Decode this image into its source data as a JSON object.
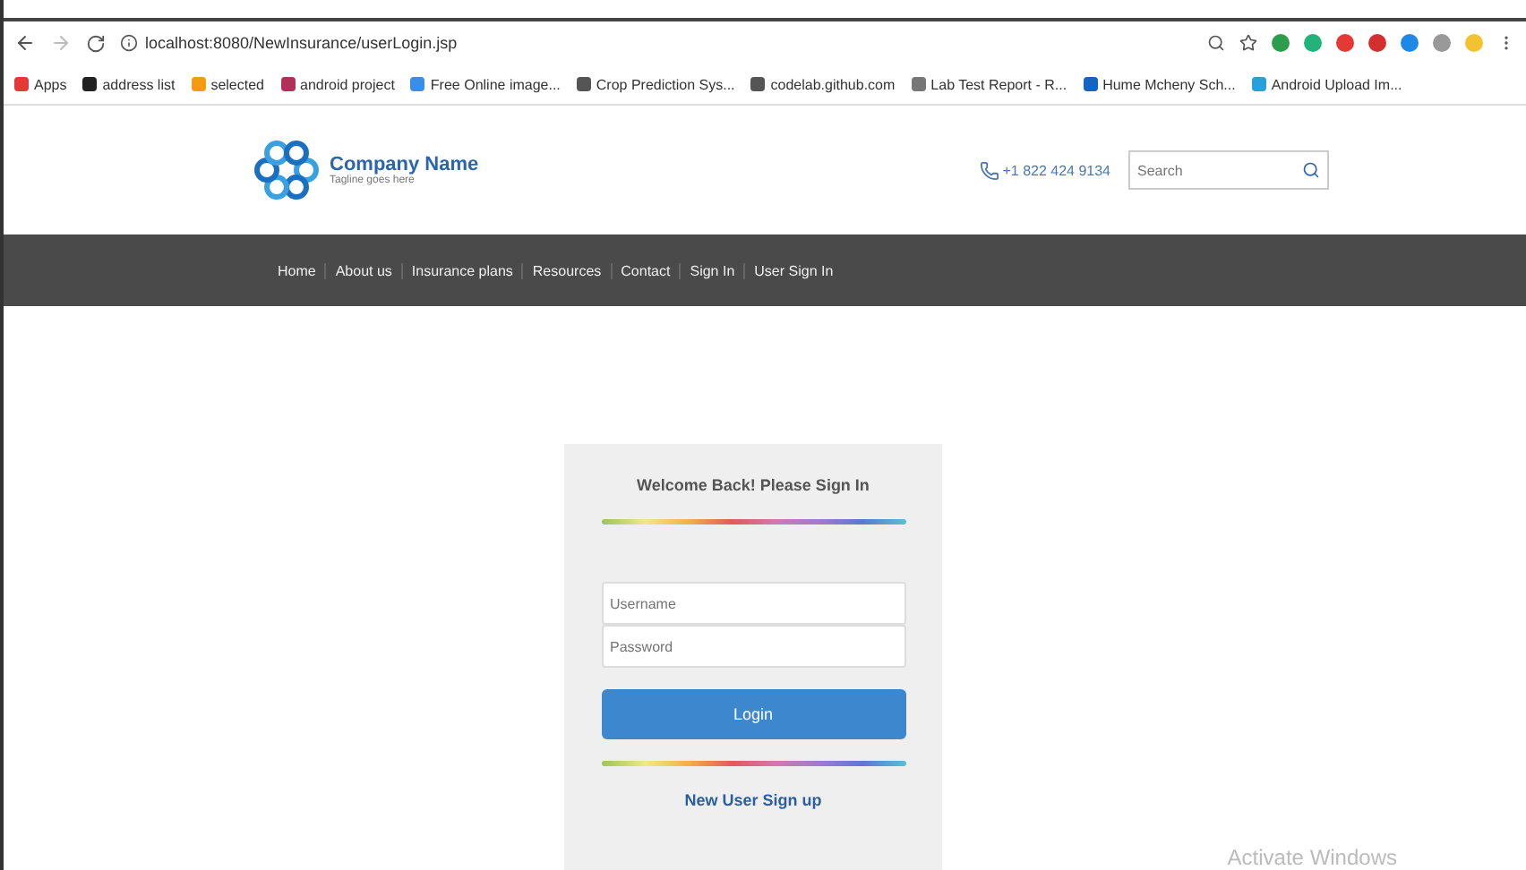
{
  "browser": {
    "url": "localhost:8080/NewInsurance/userLogin.jsp",
    "bookmarks": [
      {
        "label": "Apps",
        "color": "#e53935"
      },
      {
        "label": "address list",
        "color": "#222222"
      },
      {
        "label": "selected",
        "color": "#f39c12"
      },
      {
        "label": "android project",
        "color": "#b0305a"
      },
      {
        "label": "Free Online image...",
        "color": "#3a8ee6"
      },
      {
        "label": "Crop Prediction Sys...",
        "color": "#555555"
      },
      {
        "label": "codelab.github.com",
        "color": "#555555"
      },
      {
        "label": "Lab Test Report - R...",
        "color": "#777777"
      },
      {
        "label": "Hume Mcheny Sch...",
        "color": "#1565c0"
      },
      {
        "label": "Android Upload Im...",
        "color": "#29a0d8"
      }
    ],
    "extensions": [
      {
        "color": "#2e9d4b"
      },
      {
        "color": "#21b37a"
      },
      {
        "color": "#e53935"
      },
      {
        "color": "#d32f2f"
      },
      {
        "color": "#1e88e5"
      },
      {
        "color": "#999999"
      },
      {
        "color": "#f2c230"
      }
    ]
  },
  "header": {
    "company": "Company Name",
    "tagline": "Tagline goes here",
    "phone": "+1 822 424 9134",
    "search": {
      "placeholder": "Search"
    }
  },
  "nav": [
    "Home",
    "About us",
    "Insurance plans",
    "Resources",
    "Contact",
    "Sign In",
    "User Sign In"
  ],
  "login": {
    "title": "Welcome Back! Please Sign In",
    "username": {
      "placeholder": "Username"
    },
    "password": {
      "placeholder": "Password"
    },
    "button": "Login",
    "signup": "New User Sign up"
  },
  "overlay": "Activate Windows"
}
